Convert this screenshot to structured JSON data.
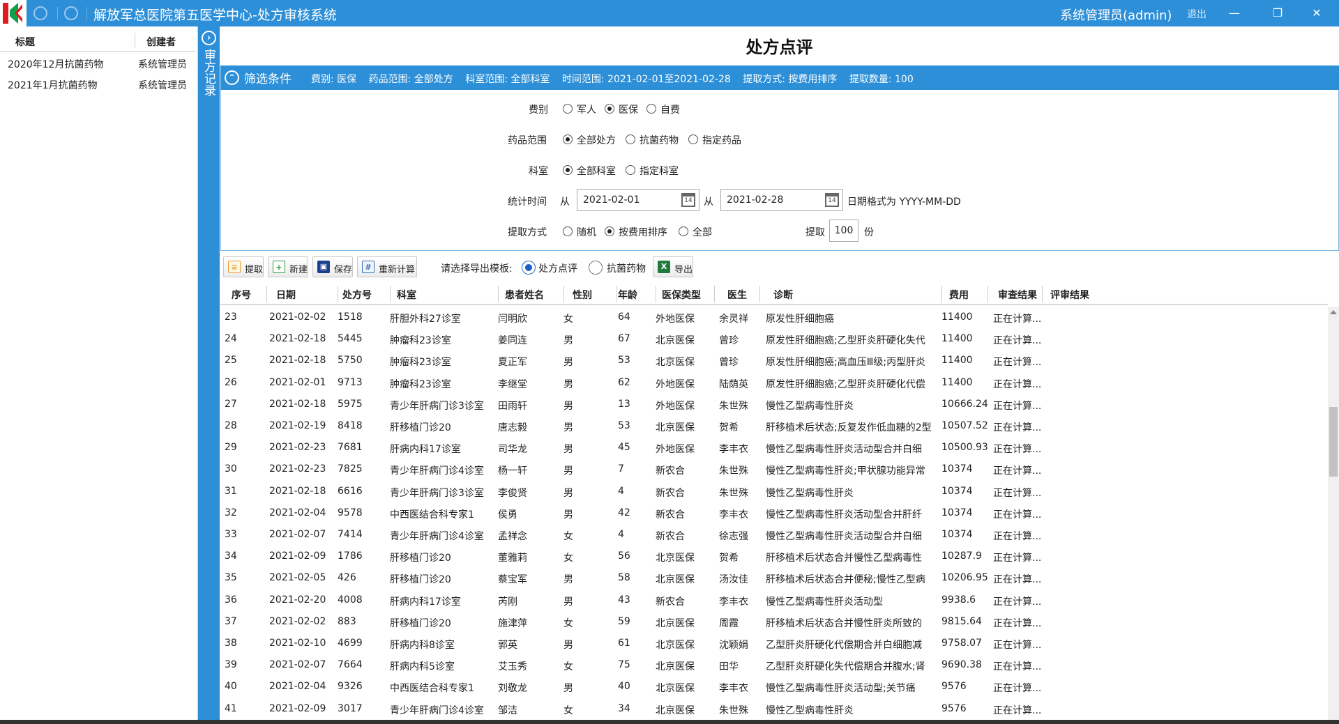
{
  "app": {
    "title": "解放军总医院第五医学中心-处方审核系统",
    "user": "系统管理员(admin)",
    "logout": "退出",
    "minimize": "—",
    "restore": "❐",
    "close": "✕"
  },
  "records_panel": {
    "vertical_title": "审方记录",
    "toggle": "›",
    "col_title": "标题",
    "col_creator": "创建者",
    "items": [
      {
        "title": "2020年12月抗菌药物",
        "creator": "系统管理员"
      },
      {
        "title": "2021年1月抗菌药物",
        "creator": "系统管理员"
      }
    ]
  },
  "page_title": "处方点评",
  "filter": {
    "toggle": "⌃",
    "title": "筛选条件",
    "summary": {
      "fee": "费别: 医保",
      "drug": "药品范围: 全部处方",
      "dept": "科室范围: 全部科室",
      "time": "时间范围: 2021-02-01至2021-02-28",
      "method": "提取方式: 按费用排序",
      "count": "提取数量: 100"
    },
    "fee_label": "费别",
    "fee_options": [
      "军人",
      "医保",
      "自费"
    ],
    "fee_selected": 1,
    "drug_label": "药品范围",
    "drug_options": [
      "全部处方",
      "抗菌药物",
      "指定药品"
    ],
    "drug_selected": 0,
    "dept_label": "科室",
    "dept_options": [
      "全部科室",
      "指定科室"
    ],
    "dept_selected": 0,
    "time_label": "统计时间",
    "from1": "从",
    "date_start": "2021-02-01",
    "from2": "从",
    "date_end": "2021-02-28",
    "date_hint": "日期格式为 YYYY-MM-DD",
    "cal_day": "14",
    "method_label": "提取方式",
    "method_options": [
      "随机",
      "按费用排序",
      "全部"
    ],
    "method_selected": 1,
    "extract_label": "提取",
    "extract_count": "100",
    "extract_unit": "份"
  },
  "toolbar": {
    "extract": "提取",
    "new": "新建",
    "save": "保存",
    "recalc": "重新计算",
    "template_label": "请选择导出模板:",
    "template_options": [
      "处方点评",
      "抗菌药物"
    ],
    "template_selected": 0,
    "export": "导出"
  },
  "table": {
    "columns": [
      "序号",
      "日期",
      "处方号",
      "科室",
      "患者姓名",
      "性别",
      "年龄",
      "医保类型",
      "医生",
      "诊断",
      "费用",
      "审查结果",
      "评审结果"
    ],
    "rows": [
      [
        "23",
        "2021-02-02",
        "1518",
        "肝胆外科27诊室",
        "闫明欣",
        "女",
        "64",
        "外地医保",
        "余灵祥",
        "原发性肝细胞癌",
        "11400",
        "正在计算...",
        ""
      ],
      [
        "24",
        "2021-02-18",
        "5445",
        "肿瘤科23诊室",
        "姜同连",
        "男",
        "67",
        "北京医保",
        "曾珍",
        "原发性肝细胞癌;乙型肝炎肝硬化失代",
        "11400",
        "正在计算...",
        ""
      ],
      [
        "25",
        "2021-02-18",
        "5750",
        "肿瘤科23诊室",
        "夏正军",
        "男",
        "53",
        "北京医保",
        "曾珍",
        "原发性肝细胞癌;高血压Ⅲ级;丙型肝炎",
        "11400",
        "正在计算...",
        ""
      ],
      [
        "26",
        "2021-02-01",
        "9713",
        "肿瘤科23诊室",
        "李继堂",
        "男",
        "62",
        "外地医保",
        "陆荫英",
        "原发性肝细胞癌;乙型肝炎肝硬化代偿",
        "11400",
        "正在计算...",
        ""
      ],
      [
        "27",
        "2021-02-18",
        "5975",
        "青少年肝病门诊3诊室",
        "田雨轩",
        "男",
        "13",
        "外地医保",
        "朱世殊",
        "慢性乙型病毒性肝炎",
        "10666.24",
        "正在计算...",
        ""
      ],
      [
        "28",
        "2021-02-19",
        "8418",
        "肝移植门诊20",
        "唐志毅",
        "男",
        "53",
        "北京医保",
        "贺希",
        "肝移植术后状态;反复发作低血糖的2型",
        "10507.52",
        "正在计算...",
        ""
      ],
      [
        "29",
        "2021-02-23",
        "7681",
        "肝病内科17诊室",
        "司华龙",
        "男",
        "45",
        "外地医保",
        "李丰衣",
        "慢性乙型病毒性肝炎活动型合并白细",
        "10500.93",
        "正在计算...",
        ""
      ],
      [
        "30",
        "2021-02-23",
        "7825",
        "青少年肝病门诊4诊室",
        "杨一轩",
        "男",
        "7",
        "新农合",
        "朱世殊",
        "慢性乙型病毒性肝炎;甲状腺功能异常",
        "10374",
        "正在计算...",
        ""
      ],
      [
        "31",
        "2021-02-18",
        "6616",
        "青少年肝病门诊3诊室",
        "李俊贤",
        "男",
        "4",
        "新农合",
        "朱世殊",
        "慢性乙型病毒性肝炎",
        "10374",
        "正在计算...",
        ""
      ],
      [
        "32",
        "2021-02-04",
        "9578",
        "中西医结合科专家1",
        "侯勇",
        "男",
        "42",
        "新农合",
        "李丰衣",
        "慢性乙型病毒性肝炎活动型合并肝纤",
        "10374",
        "正在计算...",
        ""
      ],
      [
        "33",
        "2021-02-07",
        "7414",
        "青少年肝病门诊4诊室",
        "孟祥念",
        "女",
        "4",
        "新农合",
        "徐志强",
        "慢性乙型病毒性肝炎活动型合并白细",
        "10374",
        "正在计算...",
        ""
      ],
      [
        "34",
        "2021-02-09",
        "1786",
        "肝移植门诊20",
        "董雅莉",
        "女",
        "56",
        "北京医保",
        "贺希",
        "肝移植术后状态合并慢性乙型病毒性",
        "10287.9",
        "正在计算...",
        ""
      ],
      [
        "35",
        "2021-02-05",
        "426",
        "肝移植门诊20",
        "蔡宝军",
        "男",
        "58",
        "北京医保",
        "汤汝佳",
        "肝移植术后状态合并便秘;慢性乙型病",
        "10206.95",
        "正在计算...",
        ""
      ],
      [
        "36",
        "2021-02-20",
        "4008",
        "肝病内科17诊室",
        "芮刚",
        "男",
        "43",
        "新农合",
        "李丰衣",
        "慢性乙型病毒性肝炎活动型",
        "9938.6",
        "正在计算...",
        ""
      ],
      [
        "37",
        "2021-02-02",
        "883",
        "肝移植门诊20",
        "施津萍",
        "女",
        "59",
        "北京医保",
        "周霞",
        "肝移植术后状态合并慢性肝炎所致的",
        "9815.64",
        "正在计算...",
        ""
      ],
      [
        "38",
        "2021-02-10",
        "4699",
        "肝病内科8诊室",
        "郭英",
        "男",
        "61",
        "北京医保",
        "沈颖娟",
        "乙型肝炎肝硬化代偿期合并白细胞减",
        "9758.07",
        "正在计算...",
        ""
      ],
      [
        "39",
        "2021-02-07",
        "7664",
        "肝病内科5诊室",
        "艾玉秀",
        "女",
        "75",
        "北京医保",
        "田华",
        "乙型肝炎肝硬化失代偿期合并腹水;肾",
        "9690.38",
        "正在计算...",
        ""
      ],
      [
        "40",
        "2021-02-04",
        "9326",
        "中西医结合科专家1",
        "刘敬龙",
        "男",
        "40",
        "北京医保",
        "李丰衣",
        "慢性乙型病毒性肝炎活动型;关节痛",
        "9576",
        "正在计算...",
        ""
      ],
      [
        "41",
        "2021-02-09",
        "3017",
        "青少年肝病门诊4诊室",
        "邹洁",
        "女",
        "34",
        "北京医保",
        "朱世殊",
        "慢性乙型病毒性肝炎",
        "9576",
        "正在计算...",
        ""
      ]
    ]
  }
}
